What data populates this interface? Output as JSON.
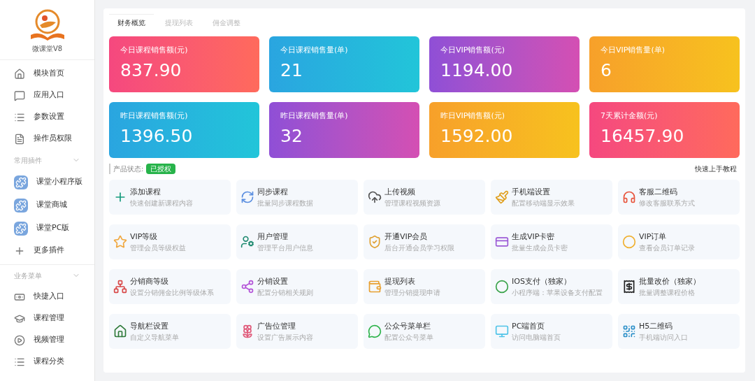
{
  "sidebar": {
    "app_name": "微课堂V8",
    "items": [
      {
        "label": "模块首页"
      },
      {
        "label": "应用入口"
      },
      {
        "label": "参数设置"
      },
      {
        "label": "操作员权限"
      }
    ],
    "sections": [
      {
        "title": "常用插件",
        "items": [
          {
            "label": "课堂小程序版"
          },
          {
            "label": "课堂商城"
          },
          {
            "label": "课堂PC版"
          },
          {
            "label": "更多插件"
          }
        ]
      },
      {
        "title": "业务菜单",
        "items": [
          {
            "label": "快捷入口"
          },
          {
            "label": "课程管理"
          },
          {
            "label": "视频管理"
          },
          {
            "label": "课程分类"
          }
        ]
      }
    ]
  },
  "tabs": [
    {
      "label": "财务概览",
      "selected": true
    },
    {
      "label": "提现列表",
      "selected": false
    },
    {
      "label": "佣金调整",
      "selected": false
    }
  ],
  "stats": [
    {
      "label": "今日课程销售额(元)",
      "value": "837.90"
    },
    {
      "label": "今日课程销售量(单)",
      "value": "21"
    },
    {
      "label": "今日VIP销售额(元)",
      "value": "1194.00"
    },
    {
      "label": "今日VIP销售量(单)",
      "value": "6"
    },
    {
      "label": "昨日课程销售额(元)",
      "value": "1396.50"
    },
    {
      "label": "昨日课程销售量(单)",
      "value": "32"
    },
    {
      "label": "昨日VIP销售额(元)",
      "value": "1592.00"
    },
    {
      "label": "7天累计金额(元)",
      "value": "16457.90"
    }
  ],
  "status": {
    "label": "产品状态:",
    "badge": "已授权"
  },
  "tutorial_link": "快速上手教程",
  "shortcuts": [
    {
      "title": "添加课程",
      "desc": "快速创建新课程内容"
    },
    {
      "title": "同步课程",
      "desc": "批量同步课程数据"
    },
    {
      "title": "上传视频",
      "desc": "管理课程视频资源"
    },
    {
      "title": "手机端设置",
      "desc": "配置移动端显示效果"
    },
    {
      "title": "客服二维码",
      "desc": "修改客服联系方式"
    },
    {
      "title": "VIP等级",
      "desc": "管理会员等级权益"
    },
    {
      "title": "用户管理",
      "desc": "管理平台用户信息"
    },
    {
      "title": "开通VIP会员",
      "desc": "后台开通会员学习权限"
    },
    {
      "title": "生成VIP卡密",
      "desc": "批量生成会员卡密"
    },
    {
      "title": "VIP订单",
      "desc": "查看会员订单记录"
    },
    {
      "title": "分销商等级",
      "desc": "设置分销佣金比例等级体系"
    },
    {
      "title": "分销设置",
      "desc": "配置分销相关规则"
    },
    {
      "title": "提现列表",
      "desc": "管理分销提现申请"
    },
    {
      "title": "IOS支付（独家）",
      "desc": "小程序端：苹果设备支付配置"
    },
    {
      "title": "批量改价（独家）",
      "desc": "批量调整课程价格"
    },
    {
      "title": "导航栏设置",
      "desc": "自定义导航菜单"
    },
    {
      "title": "广告位管理",
      "desc": "设置广告展示内容"
    },
    {
      "title": "公众号菜单栏",
      "desc": "配置公众号菜单"
    },
    {
      "title": "PC端首页",
      "desc": "访问电脑端首页"
    },
    {
      "title": "H5二维码",
      "desc": "手机端访问入口"
    }
  ]
}
